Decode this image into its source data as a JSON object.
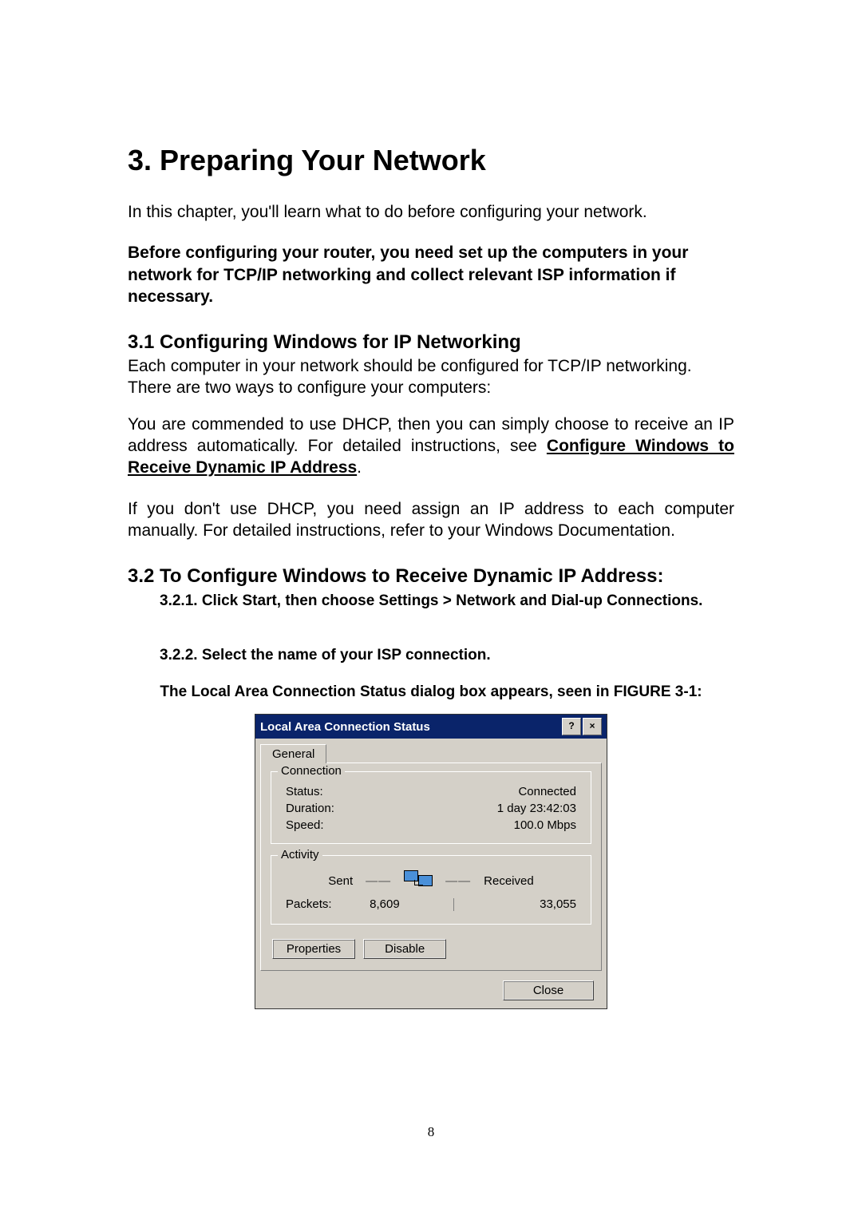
{
  "doc": {
    "h1": "3. Preparing Your Network",
    "intro": "In this chapter, you'll learn what to do before configuring your network.",
    "bold_para": "Before configuring your router, you need set up the computers in your network for TCP/IP networking and collect relevant ISP information if necessary.",
    "h2_1": "3.1 Configuring Windows for IP Networking",
    "p1": "Each computer in your network should be configured for TCP/IP networking. There are two ways to configure your computers:",
    "p2a": "You are commended to use DHCP, then you can simply choose to receive an IP address automatically. For detailed instructions, see ",
    "p2_link": "Configure Windows to Receive Dynamic IP Address",
    "p2b": ".",
    "p3": "If you don't use DHCP, you need assign an IP address to each computer manually. For detailed instructions, refer to your Windows Documentation.",
    "h2_2": "3.2 To Configure Windows to Receive Dynamic IP Address:",
    "step1": "3.2.1. Click Start, then choose Settings > Network and Dial-up Connections.",
    "step2": "3.2.2. Select the name of your ISP connection.",
    "caption": "The Local Area Connection Status dialog box appears, seen in FIGURE 3-1:",
    "page_number": "8"
  },
  "dialog": {
    "title": "Local Area Connection Status",
    "help_glyph": "?",
    "close_glyph": "×",
    "tab_general": "General",
    "group_connection": "Connection",
    "status_label": "Status:",
    "status_value": "Connected",
    "duration_label": "Duration:",
    "duration_value": "1 day 23:42:03",
    "speed_label": "Speed:",
    "speed_value": "100.0 Mbps",
    "group_activity": "Activity",
    "sent_label": "Sent",
    "received_label": "Received",
    "packets_label": "Packets:",
    "packets_sent": "8,609",
    "packets_received": "33,055",
    "btn_properties": "Properties",
    "btn_disable": "Disable",
    "btn_close": "Close"
  }
}
